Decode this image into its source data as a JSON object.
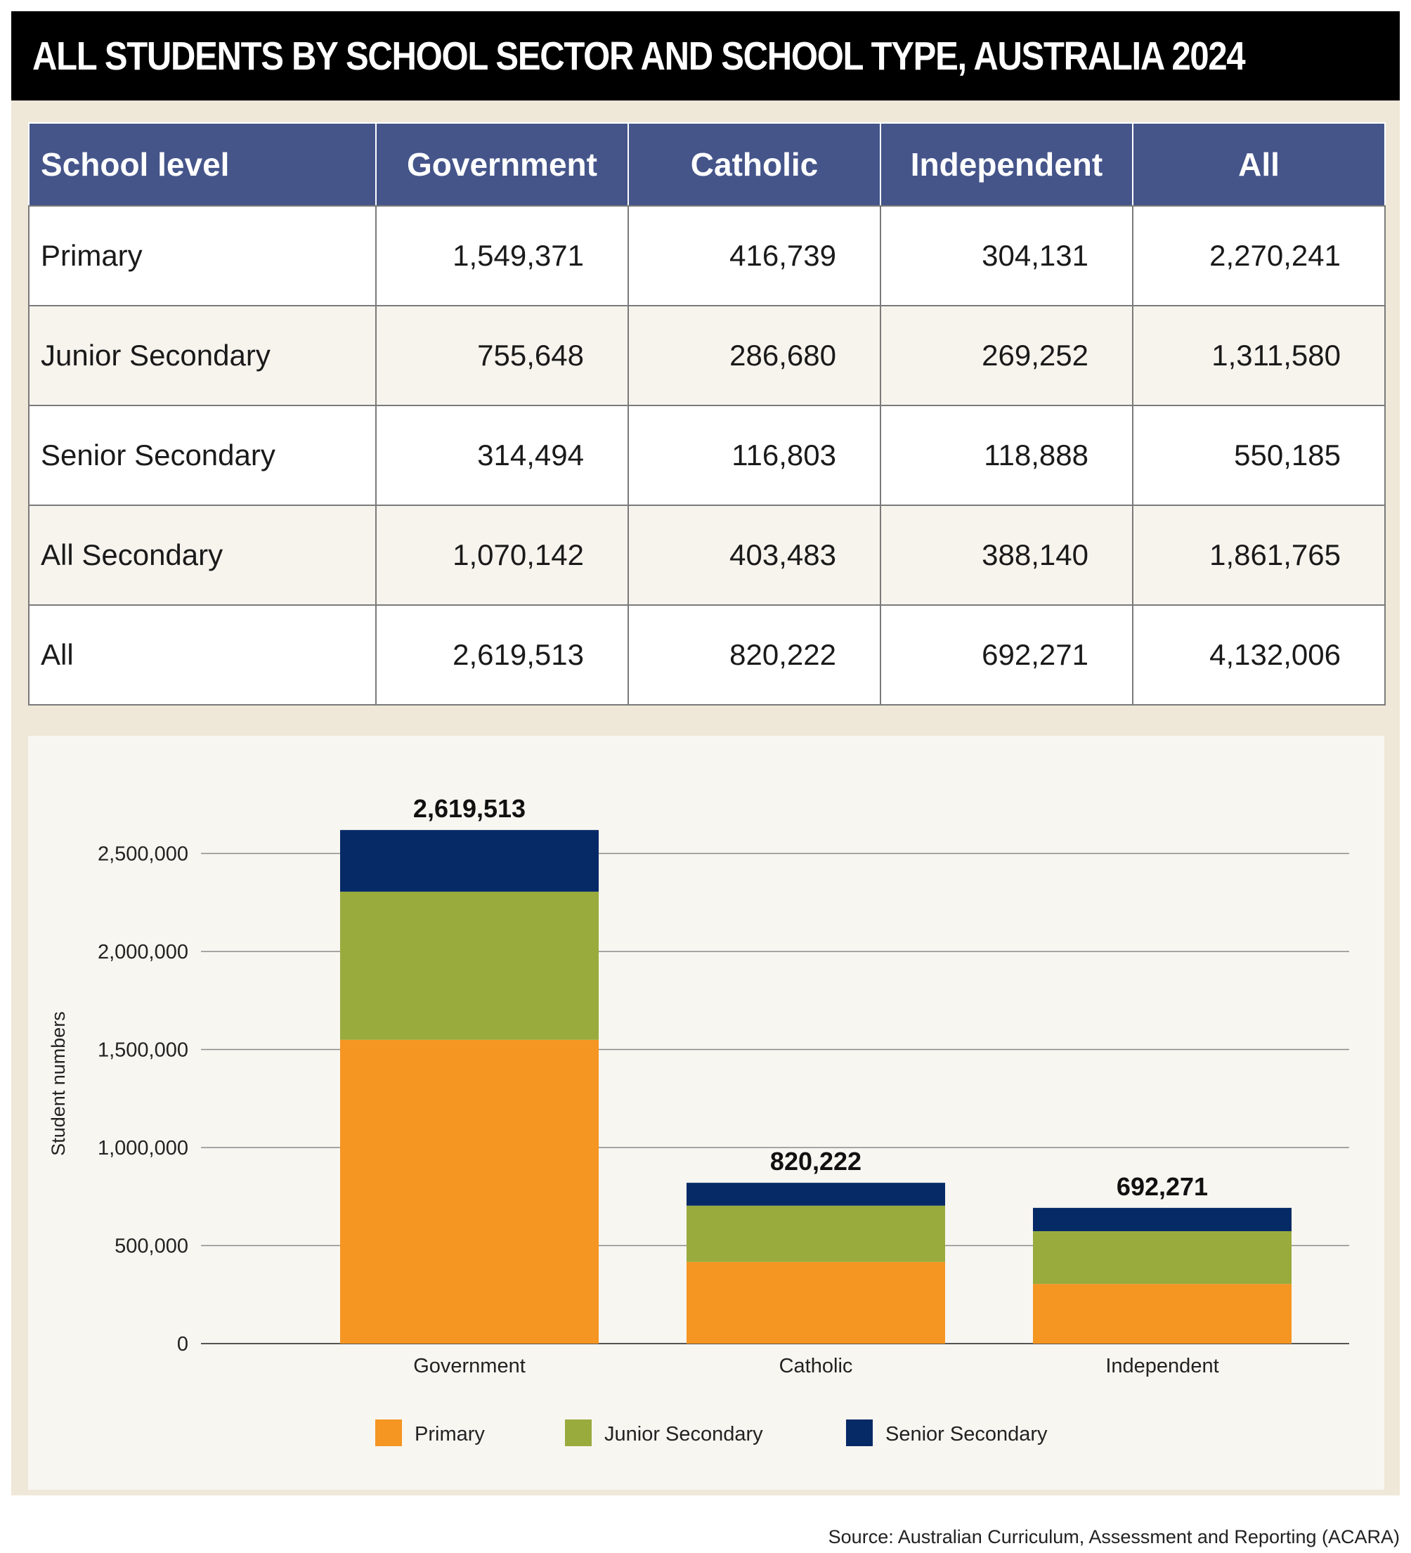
{
  "title": "ALL STUDENTS BY SCHOOL SECTOR AND SCHOOL TYPE, AUSTRALIA 2024",
  "table": {
    "headers": [
      "School level",
      "Government",
      "Catholic",
      "Independent",
      "All"
    ],
    "rows": [
      [
        "Primary",
        "1,549,371",
        "416,739",
        "304,131",
        "2,270,241"
      ],
      [
        "Junior Secondary",
        "755,648",
        "286,680",
        "269,252",
        "1,311,580"
      ],
      [
        "Senior Secondary",
        "314,494",
        "116,803",
        "118,888",
        "550,185"
      ],
      [
        "All Secondary",
        "1,070,142",
        "403,483",
        "388,140",
        "1,861,765"
      ],
      [
        "All",
        "2,619,513",
        "820,222",
        "692,271",
        "4,132,006"
      ]
    ]
  },
  "chart_data": {
    "type": "bar",
    "stacked": true,
    "categories": [
      "Government",
      "Catholic",
      "Independent"
    ],
    "series": [
      {
        "name": "Primary",
        "values": [
          1549371,
          416739,
          304131
        ],
        "color": "#f59522"
      },
      {
        "name": "Junior Secondary",
        "values": [
          755648,
          286680,
          269252
        ],
        "color": "#99ab3d"
      },
      {
        "name": "Senior Secondary",
        "values": [
          314494,
          116803,
          118888
        ],
        "color": "#062a66"
      }
    ],
    "totals": [
      2619513,
      820222,
      692271
    ],
    "total_labels": [
      "2,619,513",
      "820,222",
      "692,271"
    ],
    "ylabel": "Student numbers",
    "xlabel": "",
    "ylim": [
      0,
      2700000
    ],
    "yticks": [
      0,
      500000,
      1000000,
      1500000,
      2000000,
      2500000
    ],
    "ytick_labels": [
      "0",
      "500,000",
      "1,000,000",
      "1,500,000",
      "2,000,000",
      "2,500,000"
    ],
    "grid": true,
    "legend_position": "bottom"
  },
  "source": "Source: Australian Curriculum, Assessment and Reporting (ACARA)"
}
